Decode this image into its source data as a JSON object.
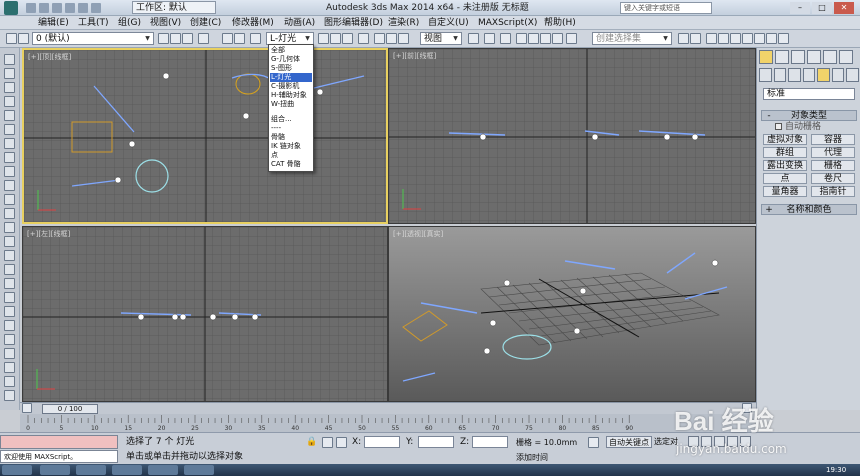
{
  "titlebar": {
    "workspace": "工作区: 默认",
    "title": "Autodesk 3ds Max  2014 x64  -  未注册版   无标题",
    "search_placeholder": "键入关键字或短语"
  },
  "menu": [
    "编辑(E)",
    "工具(T)",
    "组(G)",
    "视图(V)",
    "创建(C)",
    "修改器(M)",
    "动画(A)",
    "图形编辑器(D)",
    "渲染(R)",
    "自定义(U)",
    "MAXScript(X)",
    "帮助(H)"
  ],
  "toolbar": {
    "layer": "0 (默认)",
    "filter": "L-灯光",
    "refcoord": "视图",
    "named_sel_placeholder": "创建选择集"
  },
  "filter_dropdown": [
    "全部",
    "G-几何体",
    "S-图形",
    "L-灯光",
    "C-摄影机",
    "H-辅助对象",
    "W-扭曲",
    "组合...",
    "----",
    "骨骼",
    "IK 链对象",
    "点",
    "CAT 骨骼"
  ],
  "filter_selected_index": 3,
  "viewports": {
    "top": "[+][顶][线框]",
    "front": "[+][前][线框]",
    "left": "[+][左][线框]",
    "persp": "[+][透视][真实]"
  },
  "command_panel": {
    "category": "标准",
    "object_type": "对象类型",
    "autogrid": "自动栅格",
    "buttons": [
      "虚拟对象",
      "容器",
      "群组",
      "代理",
      "露出变换",
      "栅格",
      "点",
      "卷尺",
      "量角器",
      "指南针"
    ],
    "name_color": "名称和颜色"
  },
  "timeline": {
    "slider": "0 / 100",
    "ticks": [
      "0",
      "5",
      "10",
      "15",
      "20",
      "25",
      "30",
      "35",
      "40",
      "45",
      "50",
      "55",
      "60",
      "65",
      "70",
      "75",
      "80",
      "85",
      "90"
    ]
  },
  "status": {
    "maxscript": "欢迎使用 MAXScript。",
    "selection": "选择了 7 个 灯光",
    "hint": "单击或单击并拖动以选择对象",
    "x": "X:",
    "y": "Y:",
    "z": "Z:",
    "grid": "栅格 = 10.0mm",
    "autokey": "自动关键点",
    "selected": "选定对",
    "add_tag": "添加时间"
  },
  "clock": "19:30",
  "watermark": {
    "brand": "Bai 经验",
    "url": "jingyan.baidu.com"
  },
  "colors": {
    "viewport_bg": "#6a6a6a",
    "grid": "#5a5a5a",
    "axis": "#1e1e1e",
    "active_border": "#e8d060",
    "light_blue": "#6a8ee8",
    "select_blue": "#3366cc"
  }
}
